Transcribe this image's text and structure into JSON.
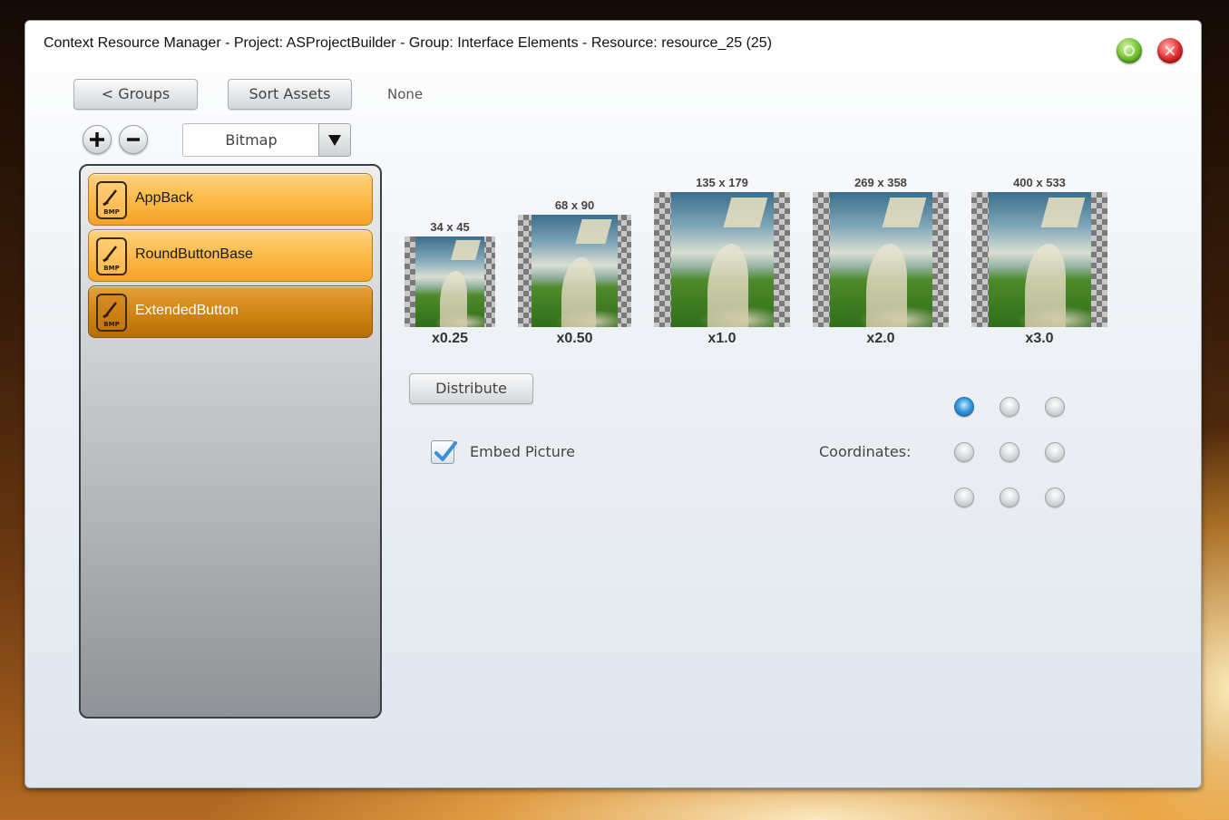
{
  "window": {
    "title": "Context Resource Manager - Project: ASProjectBuilder - Group: Interface Elements - Resource: resource_25 (25)",
    "ok_icon": "green-ok-icon",
    "close_icon": "red-close-icon"
  },
  "toolbar": {
    "groups_label": "< Groups",
    "sort_label": "Sort Assets",
    "status_text": "None"
  },
  "controls": {
    "add_icon": "plus-icon",
    "remove_icon": "minus-icon",
    "type_value": "Bitmap"
  },
  "assets": [
    {
      "name": "AppBack",
      "icon": "bmp-icon",
      "selected": false
    },
    {
      "name": "RoundButtonBase",
      "icon": "bmp-icon",
      "selected": false
    },
    {
      "name": "ExtendedButton",
      "icon": "bmp-icon",
      "selected": true
    }
  ],
  "previews": [
    {
      "size": "34 x 45",
      "scale": "x0.25"
    },
    {
      "size": "68 x 90",
      "scale": "x0.50"
    },
    {
      "size": "135 x 179",
      "scale": "x1.0"
    },
    {
      "size": "269 x 358",
      "scale": "x2.0"
    },
    {
      "size": "400 x 533",
      "scale": "x3.0"
    }
  ],
  "actions": {
    "distribute_label": "Distribute",
    "embed_label": "Embed Picture",
    "embed_checked": true,
    "coordinates_label": "Coordinates:",
    "coordinates_selected": "top-left"
  },
  "colors": {
    "accent": "#f7a929",
    "selected_item": "#c97c0e",
    "radio_on": "#3a9be0"
  }
}
